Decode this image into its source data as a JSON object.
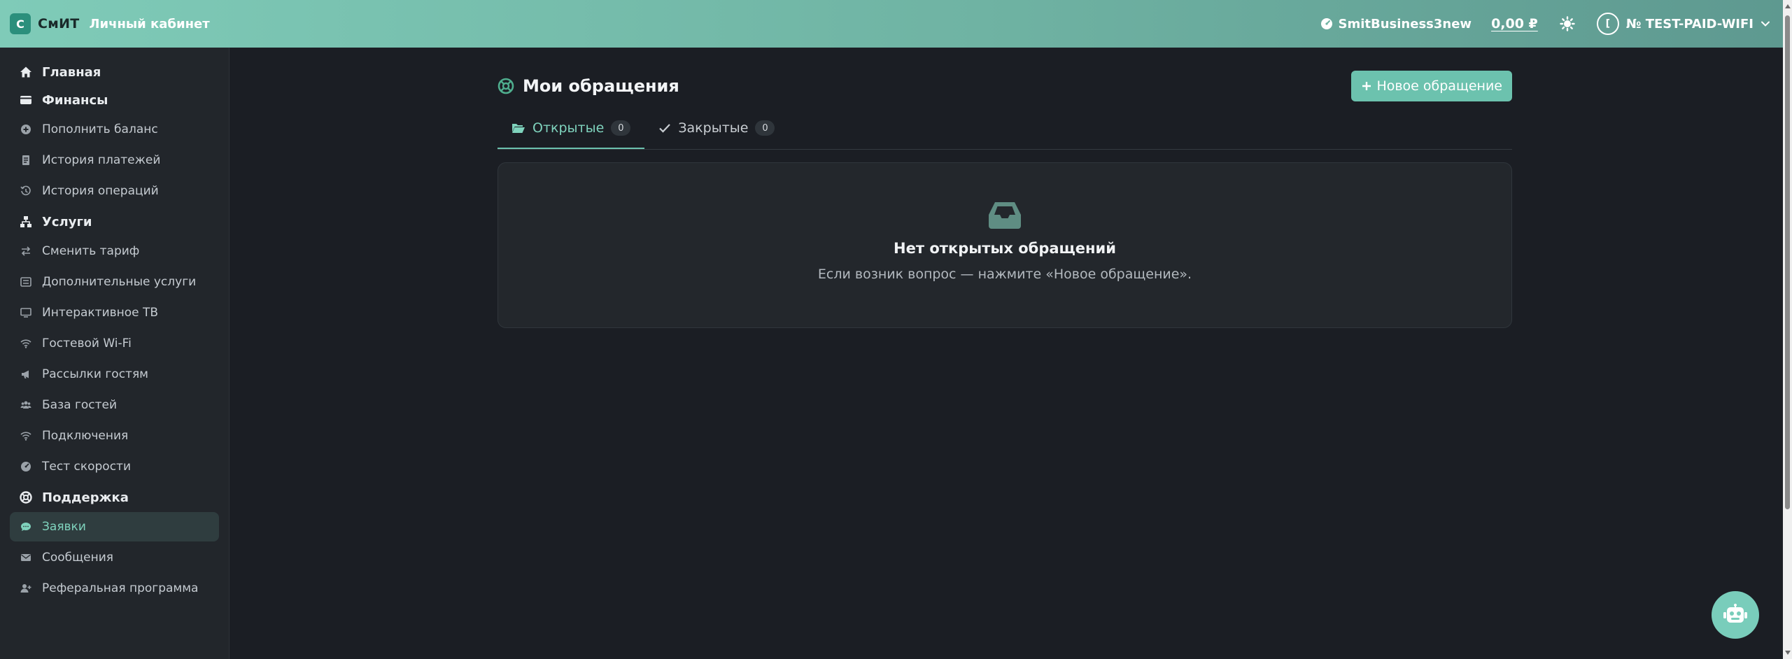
{
  "topbar": {
    "logo_letter": "С",
    "brand": "СмИТ",
    "subtitle": "Личный кабинет",
    "account_name": "SmitBusiness3new",
    "balance": "0,00 ₽",
    "avatar_letter": "[",
    "user_label": "№ TEST-PAID-WIFI"
  },
  "sidebar": {
    "sections": [
      {
        "label": "Главная",
        "icon": "home-icon"
      },
      {
        "label": "Финансы",
        "icon": "wallet-icon"
      },
      {
        "label": "Услуги",
        "icon": "sitemap-icon"
      },
      {
        "label": "Поддержка",
        "icon": "lifebuoy-icon"
      }
    ],
    "finance_items": [
      {
        "label": "Пополнить баланс",
        "icon": "plus-circle-icon"
      },
      {
        "label": "История платежей",
        "icon": "receipt-icon"
      },
      {
        "label": "История операций",
        "icon": "history-icon"
      }
    ],
    "service_items": [
      {
        "label": "Сменить тариф",
        "icon": "swap-icon"
      },
      {
        "label": "Дополнительные услуги",
        "icon": "list-icon"
      },
      {
        "label": "Интерактивное ТВ",
        "icon": "tv-icon"
      },
      {
        "label": "Гостевой Wi-Fi",
        "icon": "wifi-icon"
      },
      {
        "label": "Рассылки гостям",
        "icon": "megaphone-icon"
      },
      {
        "label": "База гостей",
        "icon": "users-icon"
      },
      {
        "label": "Подключения",
        "icon": "wifi-icon"
      },
      {
        "label": "Тест скорости",
        "icon": "gauge-icon"
      }
    ],
    "support_items": [
      {
        "label": "Заявки",
        "icon": "chat-icon",
        "active": true
      },
      {
        "label": "Сообщения",
        "icon": "envelope-icon"
      },
      {
        "label": "Реферальная программа",
        "icon": "user-plus-icon"
      }
    ]
  },
  "main": {
    "title": "Мои обращения",
    "new_button": "Новое обращение",
    "tabs": [
      {
        "label": "Открытые",
        "count": "0",
        "active": true
      },
      {
        "label": "Закрытые",
        "count": "0"
      }
    ],
    "empty": {
      "title": "Нет открытых обращений",
      "text": "Если возник вопрос — нажмите «Новое обращение»."
    }
  },
  "colors": {
    "accent": "#6cc2ae",
    "accent_text": "#7fd3bd",
    "background": "#1b1e24",
    "sidebar": "#22262b"
  }
}
